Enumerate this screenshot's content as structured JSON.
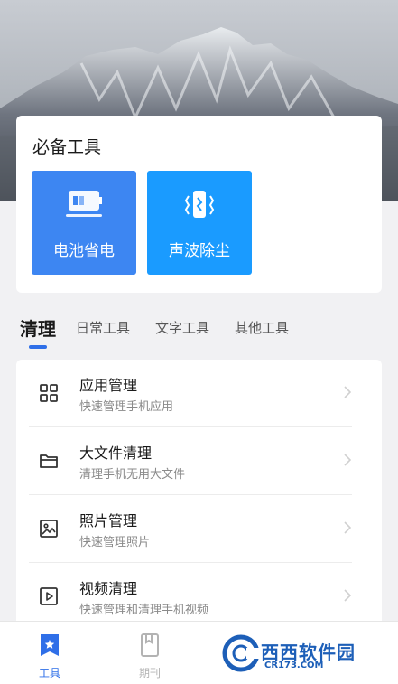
{
  "essential_tools": {
    "title": "必备工具",
    "items": [
      {
        "label": "电池省电",
        "icon": "battery-icon",
        "color": "#3d86f2"
      },
      {
        "label": "声波除尘",
        "icon": "phone-vibrate-icon",
        "color": "#1a9bff"
      }
    ]
  },
  "tabs": [
    {
      "label": "清理",
      "active": true
    },
    {
      "label": "日常工具",
      "active": false
    },
    {
      "label": "文字工具",
      "active": false
    },
    {
      "label": "其他工具",
      "active": false
    }
  ],
  "list": [
    {
      "title": "应用管理",
      "subtitle": "快速管理手机应用",
      "icon": "apps-grid-icon"
    },
    {
      "title": "大文件清理",
      "subtitle": "清理手机无用大文件",
      "icon": "folder-icon"
    },
    {
      "title": "照片管理",
      "subtitle": "快速管理照片",
      "icon": "image-icon"
    },
    {
      "title": "视频清理",
      "subtitle": "快速管理和清理手机视频",
      "icon": "video-icon"
    }
  ],
  "bottom_nav": [
    {
      "label": "工具",
      "icon": "bookmark-star-icon",
      "active": true
    },
    {
      "label": "期刊",
      "icon": "journal-icon",
      "active": false
    }
  ],
  "watermark": {
    "text": "西西软件园",
    "url": "CR173.COM"
  },
  "colors": {
    "accent": "#2f6fe8",
    "tile1": "#3d86f2",
    "tile2": "#1a9bff"
  }
}
